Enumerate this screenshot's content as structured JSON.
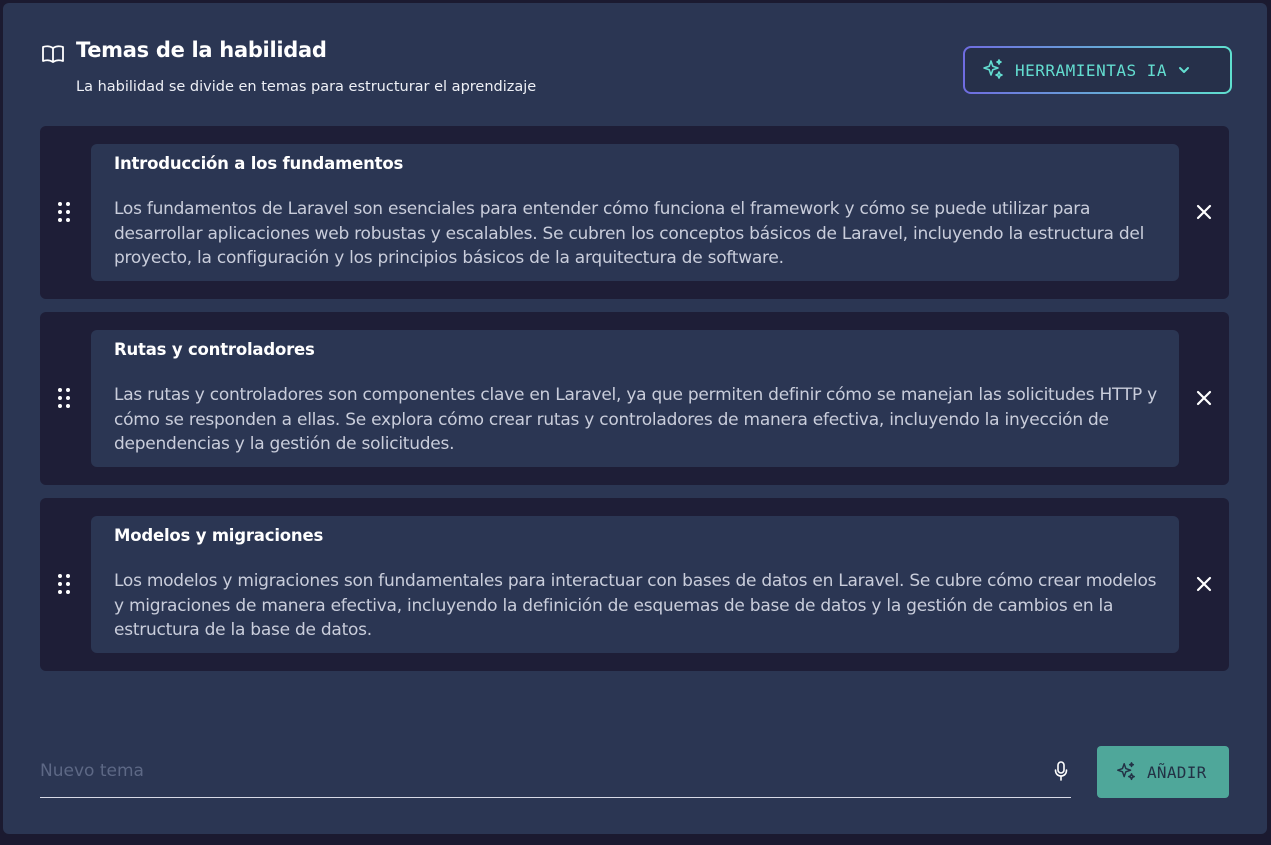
{
  "header": {
    "icon": "book-open-icon",
    "title": "Temas de la habilidad",
    "subtitle": "La habilidad se divide en temas para estructurar el aprendizaje"
  },
  "ai_tools": {
    "label": "HERRAMIENTAS IA",
    "icon": "sparkles-icon",
    "dropdown_icon": "chevron-down-icon"
  },
  "topics": [
    {
      "title": "Introducción a los fundamentos",
      "description": "Los fundamentos de Laravel son esenciales para entender cómo funciona el framework y cómo se puede utilizar para desarrollar aplicaciones web robustas y escalables. Se cubren los conceptos básicos de Laravel, incluyendo la estructura del proyecto, la configuración y los principios básicos de la arquitectura de software."
    },
    {
      "title": "Rutas y controladores",
      "description": "Las rutas y controladores son componentes clave en Laravel, ya que permiten definir cómo se manejan las solicitudes HTTP y cómo se responden a ellas. Se explora cómo crear rutas y controladores de manera efectiva, incluyendo la inyección de dependencias y la gestión de solicitudes."
    },
    {
      "title": "Modelos y migraciones",
      "description": "Los modelos y migraciones son fundamentales para interactuar con bases de datos en Laravel. Se cubre cómo crear modelos y migraciones de manera efectiva, incluyendo la definición de esquemas de base de datos y la gestión de cambios en la estructura de la base de datos."
    }
  ],
  "new_topic": {
    "placeholder": "Nuevo tema",
    "value": "",
    "mic_icon": "microphone-icon"
  },
  "add_button": {
    "label": "AÑADIR",
    "icon": "sparkles-icon"
  },
  "colors": {
    "background": "#1b1a30",
    "panel": "#2b3653",
    "card": "#1e1e37",
    "accent_teal": "#63ddd0",
    "accent_purple": "#6f6ce0",
    "add_button": "#4fa79a"
  }
}
